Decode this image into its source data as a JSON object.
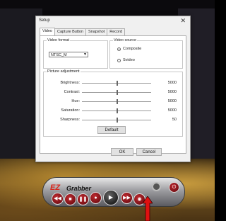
{
  "dialog": {
    "title": "Setup",
    "close": "✕",
    "tabs": [
      "Video",
      "Capture Button",
      "Snapshot",
      "Record"
    ],
    "video_format": {
      "label": "Video format",
      "value": "NTSC_M"
    },
    "video_source": {
      "label": "Video source",
      "options": [
        "Composite",
        "Svideo"
      ],
      "selected": "Composite"
    },
    "picture_adjustment": {
      "label": "Picture adjustment",
      "rows": [
        {
          "name": "Brightness:",
          "value": "5000",
          "level": 0.5
        },
        {
          "name": "Contrast:",
          "value": "5000",
          "level": 0.5
        },
        {
          "name": "Hue:",
          "value": "5000",
          "level": 0.5
        },
        {
          "name": "Saturation:",
          "value": "5000",
          "level": 0.5
        },
        {
          "name": "Sharpness:",
          "value": "50",
          "level": 0.5
        }
      ]
    },
    "default_button": "Default",
    "ok_button": "OK",
    "cancel_button": "Cancel"
  },
  "ez_grabber": {
    "logo": "EZ",
    "name": "Grabber",
    "controls": [
      "rewind-icon",
      "stop-icon",
      "pause-icon",
      "record-icon",
      "play-icon",
      "fast-forward-icon",
      "snapshot-icon"
    ]
  },
  "colors": {
    "accent_red": "#d8261c",
    "dialog_bg": "#f0f0f0"
  }
}
